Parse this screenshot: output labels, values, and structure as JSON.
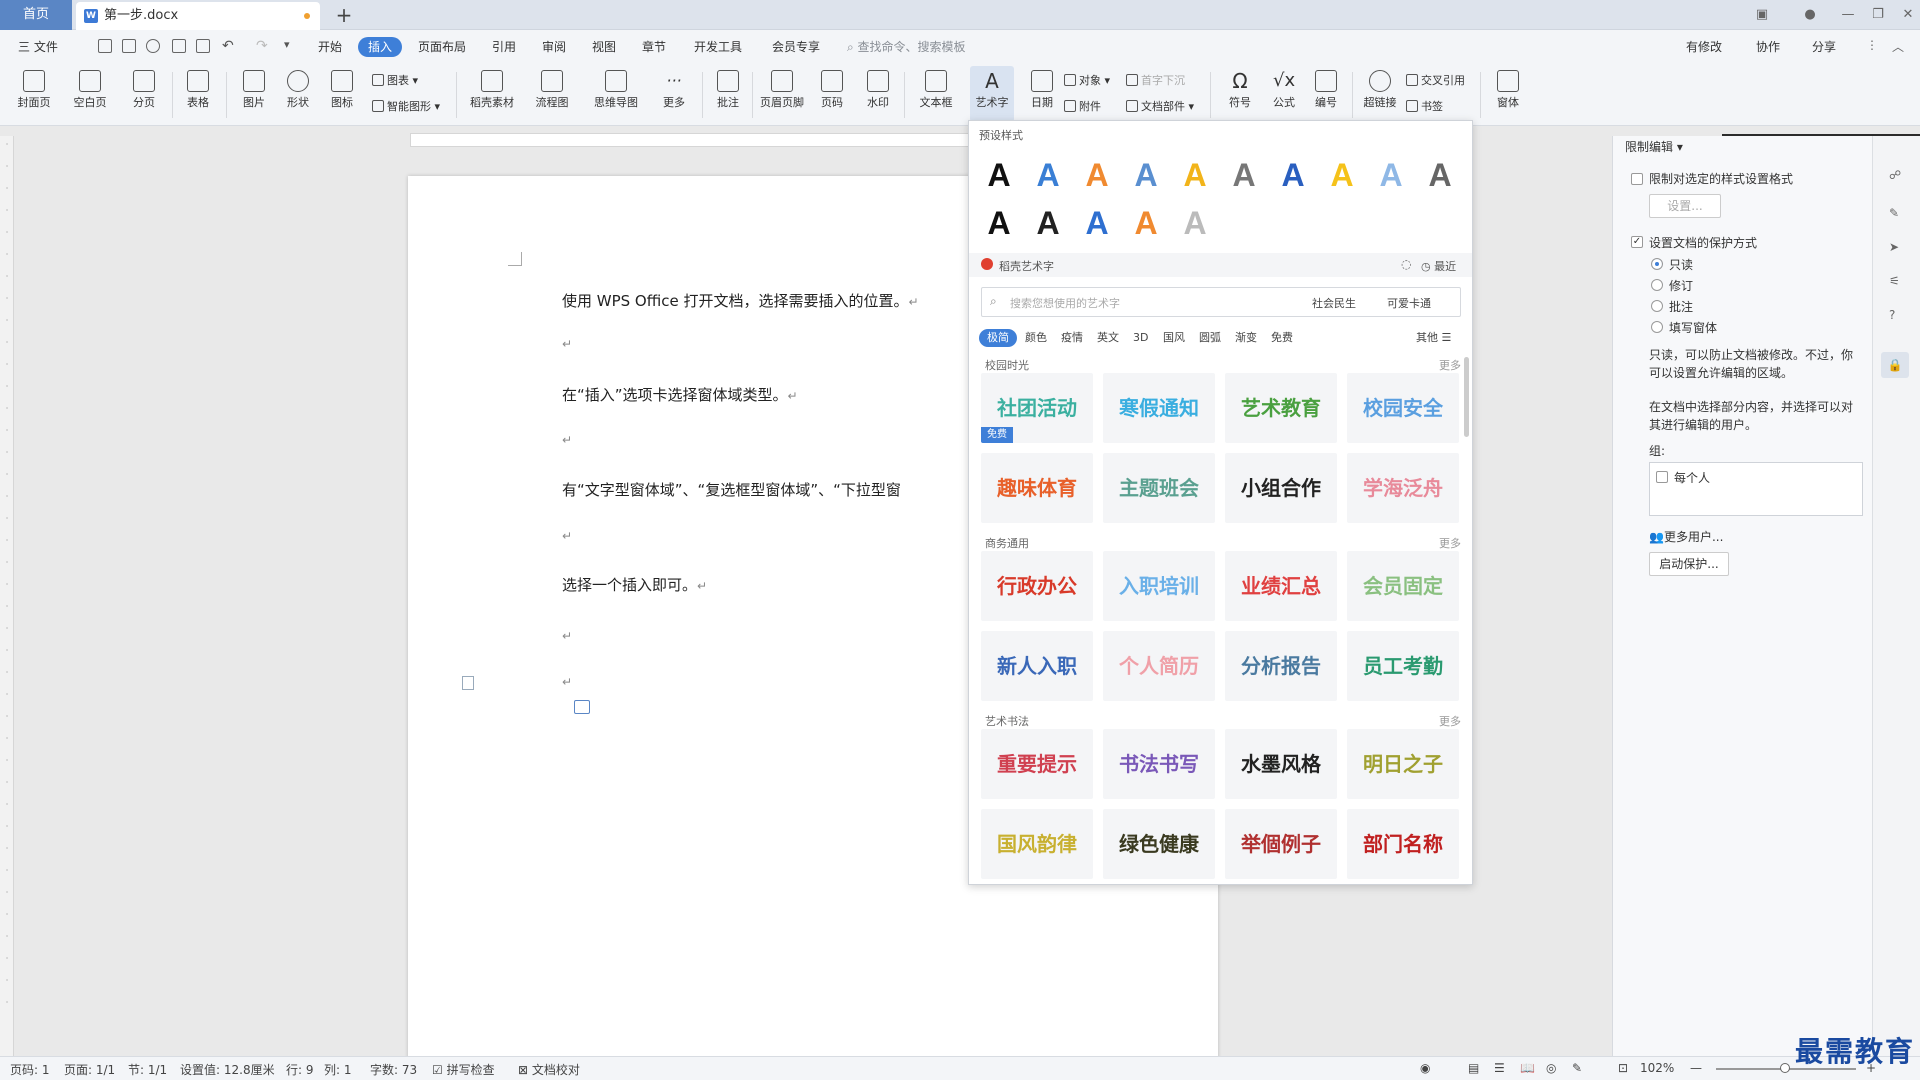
{
  "tabs": {
    "home": "首页",
    "doc_title": "第一步.docx",
    "add": "+"
  },
  "menu": {
    "file": "三 文件",
    "items": [
      "开始",
      "插入",
      "页面布局",
      "引用",
      "审阅",
      "视图",
      "章节",
      "开发工具",
      "会员专享"
    ],
    "active_index": 1,
    "search": "查找命令、搜索模板",
    "right": [
      "有修改",
      "协作",
      "分享"
    ]
  },
  "ribbon": {
    "cover": "封面页",
    "blank": "空白页",
    "pagebreak": "分页",
    "table": "表格",
    "picture": "图片",
    "shape": "形状",
    "icons": "图标",
    "chart": "图表",
    "smartart": "智能图形",
    "material": "稻壳素材",
    "flow": "流程图",
    "mindmap": "思维导图",
    "more": "更多",
    "comment": "批注",
    "header": "页眉页脚",
    "pagenum": "页码",
    "watermark": "水印",
    "textbox": "文本框",
    "arttext": "艺术字",
    "date": "日期",
    "object": "对象",
    "attachment": "附件",
    "dropcap": "首字下沉",
    "docpart": "文档部件",
    "symbol": "符号",
    "formula": "公式",
    "numbering": "编号",
    "crossref": "交叉引用",
    "hyperlink": "超链接",
    "bookmark": "书签",
    "formfield": "窗体"
  },
  "document": {
    "paragraphs": [
      "使用 WPS Office 打开文档，选择需要插入的位置。",
      "",
      "在“插入”选项卡选择窗体域类型。",
      "",
      "有“文字型窗体域”、“复选框型窗体域”、“下拉型窗",
      "",
      "选择一个插入即可。",
      "",
      ""
    ],
    "para_mark": "↵"
  },
  "panel": {
    "preset_title": "预设样式",
    "preset_letter": "A",
    "preset_colors": [
      "#111111",
      "#3a7fd5",
      "#f08a30",
      "#5a8fd0",
      "#f2b41a",
      "#777777",
      "#2a5fbf",
      "#f5c21a",
      "#8fb8e6",
      "#666666",
      "#111111",
      "#222222",
      "#2e6fd0",
      "#f08a30",
      "#bbbbbb"
    ],
    "daoke_title": "稻壳艺术字",
    "recent": "最近",
    "search_placeholder": "搜索您想使用的艺术字",
    "search_chips": [
      "社会民生",
      "可爱卡通"
    ],
    "categories": [
      "极简",
      "颜色",
      "疫情",
      "英文",
      "3D",
      "国风",
      "圆弧",
      "渐变",
      "免费"
    ],
    "other": "其他 ☰",
    "sections": [
      {
        "title": "校园时光",
        "more": "更多",
        "tiles": [
          {
            "text": "社团活动",
            "color": "#3bb0a0",
            "badge": "免费"
          },
          {
            "text": "寒假通知",
            "color": "#3aaee0"
          },
          {
            "text": "艺术教育",
            "color": "#4aa040"
          },
          {
            "text": "校园安全",
            "color": "#5a9fe0"
          },
          {
            "text": "趣味体育",
            "color": "#e8602a"
          },
          {
            "text": "主题班会",
            "color": "#5aa090"
          },
          {
            "text": "小组合作",
            "color": "#222222"
          },
          {
            "text": "学海泛舟",
            "color": "#e88a9a"
          }
        ]
      },
      {
        "title": "商务通用",
        "more": "更多",
        "tiles": [
          {
            "text": "行政办公",
            "color": "#d83a2a"
          },
          {
            "text": "入职培训",
            "color": "#6ab0e8"
          },
          {
            "text": "业绩汇总",
            "color": "#e04040"
          },
          {
            "text": "会员固定",
            "color": "#8ac080"
          },
          {
            "text": "新人入职",
            "color": "#3a68b8"
          },
          {
            "text": "个人简历",
            "color": "#f0a0a8"
          },
          {
            "text": "分析报告",
            "color": "#4a7aa0"
          },
          {
            "text": "员工考勤",
            "color": "#2a9a70"
          }
        ]
      },
      {
        "title": "艺术书法",
        "more": "更多",
        "tiles": [
          {
            "text": "重要提示",
            "color": "#d04050"
          },
          {
            "text": "书法书写",
            "color": "#7a58b8"
          },
          {
            "text": "水墨风格",
            "color": "#222222"
          },
          {
            "text": "明日之子",
            "color": "#a0a030"
          },
          {
            "text": "国风韵律",
            "color": "#c8b030"
          },
          {
            "text": "绿色健康",
            "color": "#3a3a20"
          },
          {
            "text": "举個例子",
            "color": "#b03030"
          },
          {
            "text": "部门名称",
            "color": "#c02020"
          }
        ]
      }
    ]
  },
  "rightpane": {
    "title": "限制编辑",
    "limit_format": "限制对选定的样式设置格式",
    "settings_btn": "设置...",
    "set_protection": "设置文档的保护方式",
    "options": [
      "只读",
      "修订",
      "批注",
      "填写窗体"
    ],
    "selected_option": 0,
    "desc1": "只读，可以防止文档被修改。不过，你可以设置允许编辑的区域。",
    "desc2": "在文档中选择部分内容，并选择可以对其进行编辑的用户。",
    "group_label": "组:",
    "everyone": "每个人",
    "more_users": "更多用户...",
    "start_protect": "启动保护..."
  },
  "status": {
    "page": "页码: 1",
    "pages": "页面: 1/1",
    "section": "节: 1/1",
    "setting": "设置值: 12.8厘米",
    "row": "行: 9",
    "col": "列: 1",
    "words": "字数: 73",
    "spell": "拼写检查",
    "proof": "文档校对",
    "zoom": "102%"
  },
  "watermark_text": "最需教育"
}
